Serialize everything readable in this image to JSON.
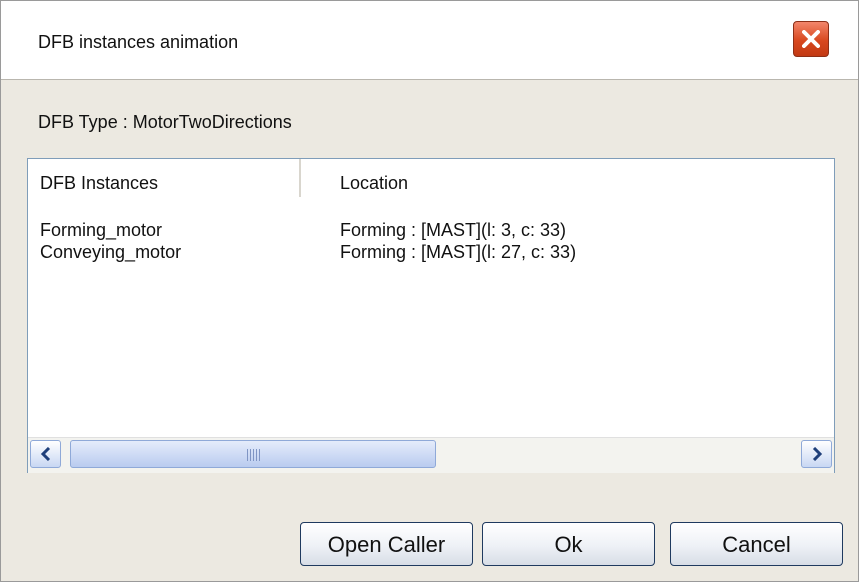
{
  "dialog": {
    "title": "DFB instances animation",
    "close_icon": "close-icon",
    "dfb_type_label": "DFB Type : MotorTwoDirections"
  },
  "list": {
    "columns": [
      "DFB Instances",
      "Location"
    ],
    "rows": [
      {
        "instance": "Forming_motor",
        "location": "Forming : [MAST](l: 3, c: 33)"
      },
      {
        "instance": "Conveying_motor",
        "location": "Forming : [MAST](l: 27, c: 33)"
      }
    ],
    "scrollbar": {
      "left_icon": "chevron-left-icon",
      "right_icon": "chevron-right-icon"
    }
  },
  "buttons": {
    "open_caller": "Open Caller",
    "ok": "Ok",
    "cancel": "Cancel"
  },
  "colors": {
    "close_button": "#d8481f",
    "list_border": "#7f9db9",
    "scroll_accent": "#b9cbef"
  }
}
